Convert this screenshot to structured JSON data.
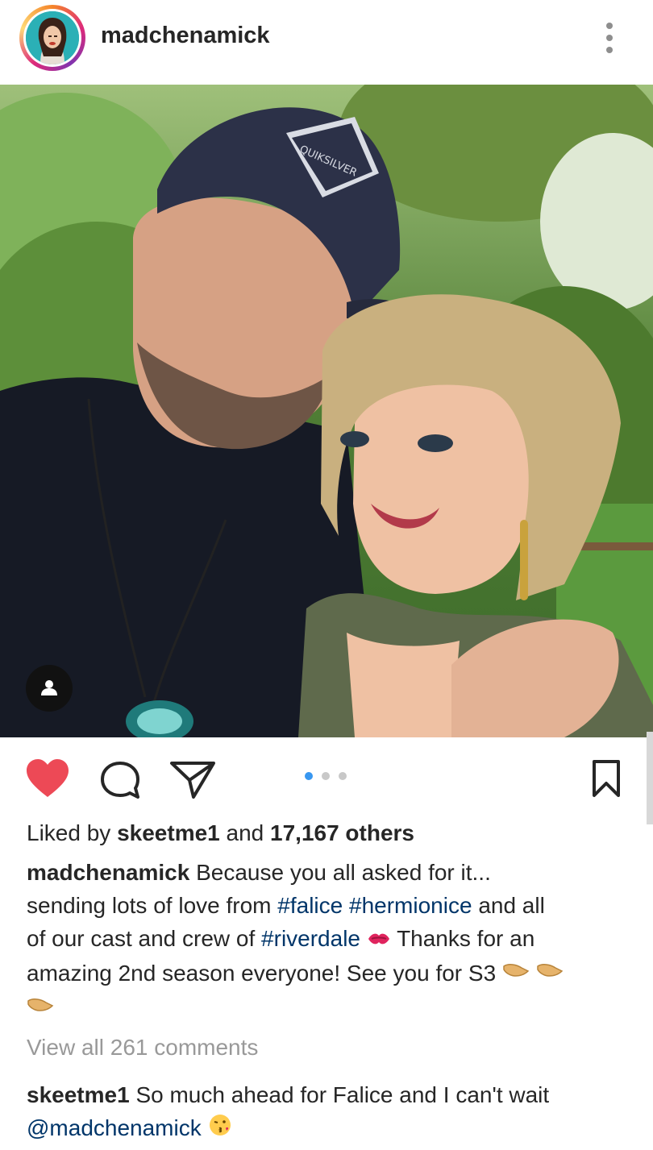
{
  "post": {
    "username": "madchenamick",
    "likes": {
      "prefix": "Liked by",
      "liker": "skeetme1",
      "conjunction": "and",
      "others": "17,167 others"
    },
    "carousel": {
      "total": 3,
      "active_index": 0
    },
    "caption": {
      "author": "madchenamick",
      "line1_text": "Because you all asked for it...",
      "line2_text": "sending lots of love from",
      "hashtag1": "#falice",
      "hashtag2": "#hermionice",
      "line2_tail": "and all",
      "line3_text": "of our cast and crew of",
      "hashtag3": "#riverdale",
      "line3_tail": "Thanks for an",
      "line4_text": "amazing 2nd season everyone! See you for S3"
    },
    "view_all_comments": "View all 261 comments",
    "top_comment": {
      "author": "skeetme1",
      "text": "So much ahead for Falice and I can't wait",
      "mention": "@madchenamick"
    }
  },
  "icons": {
    "more": "more-vertical-icon",
    "like": "heart-icon",
    "comment": "comment-icon",
    "share": "paper-plane-icon",
    "save": "bookmark-icon",
    "tag": "user-tag-icon"
  },
  "colors": {
    "heart": "#ed4956",
    "hashtag": "#003569",
    "active_dot": "#3897f0",
    "muted_text": "#999999"
  }
}
